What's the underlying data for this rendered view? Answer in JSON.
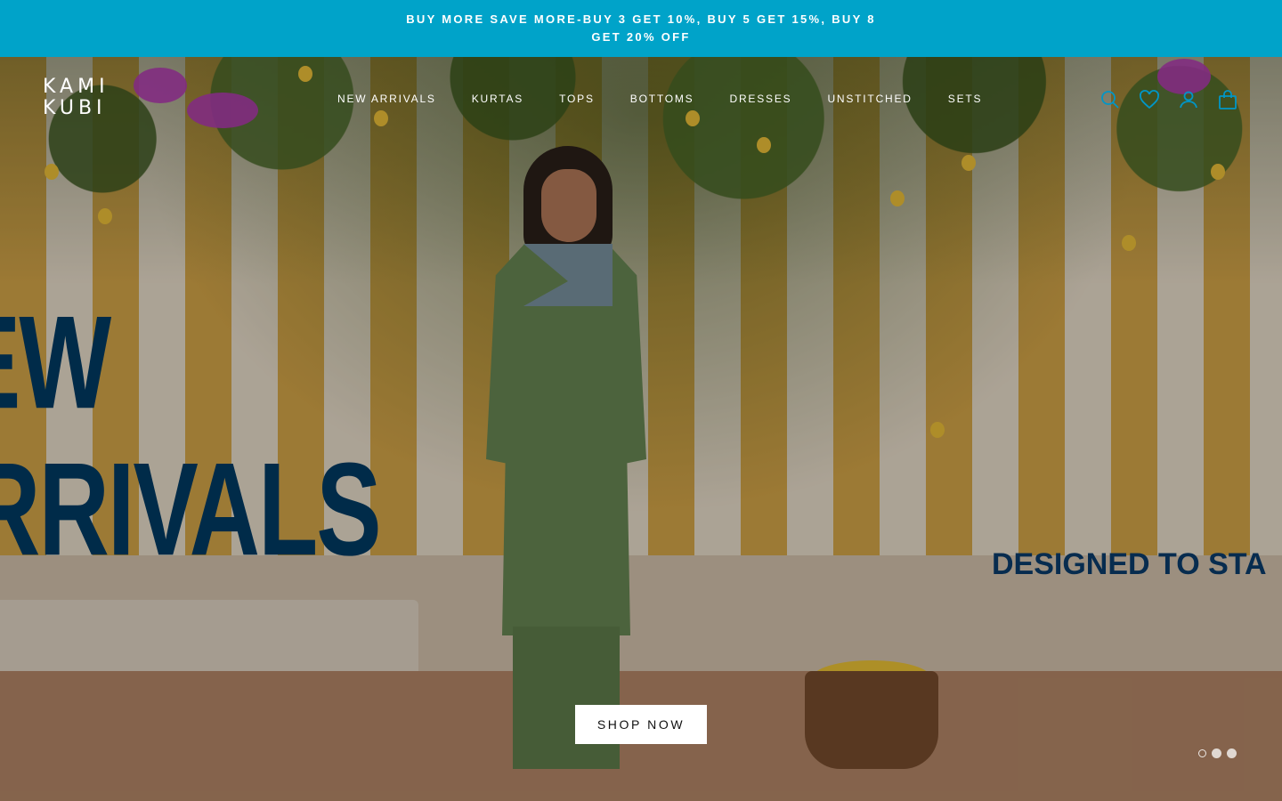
{
  "announcement": {
    "text": "BUY MORE SAVE MORE-BUY 3 GET 10%, BUY 5 GET 15%, BUY 8 GET 20% OFF"
  },
  "header": {
    "logo_line1": "KAMI",
    "logo_line2": "KUBI",
    "nav": [
      "NEW ARRIVALS",
      "KURTAS",
      "TOPS",
      "BOTTOMS",
      "DRESSES",
      "UNSTITCHED",
      "SETS"
    ],
    "icons": [
      "search-icon",
      "heart-icon",
      "account-icon",
      "bag-icon"
    ],
    "icon_color": "#0096c7"
  },
  "hero": {
    "headline_line1": "EW",
    "headline_line2": "RRIVALS",
    "tagline": "DESIGNED TO STA",
    "cta_label": "SHOP NOW",
    "slide_count": 3,
    "active_slide": 1
  },
  "colors": {
    "announcement_bg": "#00a3c9",
    "headline": "#003c66"
  }
}
